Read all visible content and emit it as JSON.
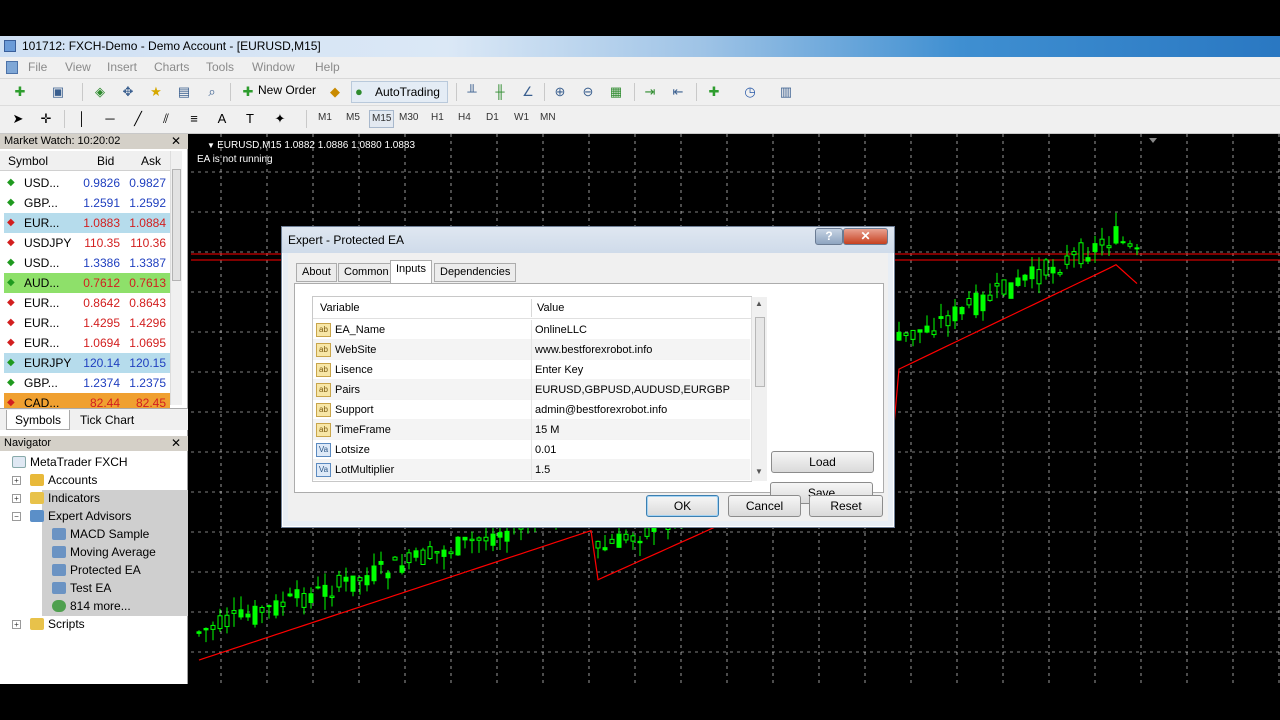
{
  "window": {
    "title": "101712: FXCH-Demo - Demo Account - [EURUSD,M15]"
  },
  "menu": [
    "File",
    "View",
    "Insert",
    "Charts",
    "Tools",
    "Window",
    "Help"
  ],
  "toolbar": {
    "new_order_label": "New Order",
    "autotrading_label": "AutoTrading",
    "timeframes": [
      "M1",
      "M5",
      "M15",
      "M30",
      "H1",
      "H4",
      "D1",
      "W1",
      "MN"
    ],
    "active_timeframe": "M15"
  },
  "market_watch": {
    "title": "Market Watch: 10:20:02",
    "columns": {
      "symbol": "Symbol",
      "bid": "Bid",
      "ask": "Ask"
    },
    "rows": [
      {
        "symbol": "USD...",
        "bid": "0.9826",
        "ask": "0.9827",
        "dir": "up",
        "bg": "#ffffff",
        "color": "#1f3fbf"
      },
      {
        "symbol": "GBP...",
        "bid": "1.2591",
        "ask": "1.2592",
        "dir": "up",
        "bg": "#ffffff",
        "color": "#1f3fbf"
      },
      {
        "symbol": "EUR...",
        "bid": "1.0883",
        "ask": "1.0884",
        "dir": "down",
        "bg": "#b6dcec",
        "color": "#d21f1f"
      },
      {
        "symbol": "USDJPY",
        "bid": "110.35",
        "ask": "110.36",
        "dir": "down",
        "bg": "#ffffff",
        "color": "#d21f1f"
      },
      {
        "symbol": "USD...",
        "bid": "1.3386",
        "ask": "1.3387",
        "dir": "up",
        "bg": "#ffffff",
        "color": "#1f3fbf"
      },
      {
        "symbol": "AUD...",
        "bid": "0.7612",
        "ask": "0.7613",
        "dir": "up",
        "bg": "#8ee06a",
        "color": "#d21f1f"
      },
      {
        "symbol": "EUR...",
        "bid": "0.8642",
        "ask": "0.8643",
        "dir": "down",
        "bg": "#ffffff",
        "color": "#d21f1f"
      },
      {
        "symbol": "EUR...",
        "bid": "1.4295",
        "ask": "1.4296",
        "dir": "down",
        "bg": "#ffffff",
        "color": "#d21f1f"
      },
      {
        "symbol": "EUR...",
        "bid": "1.0694",
        "ask": "1.0695",
        "dir": "down",
        "bg": "#ffffff",
        "color": "#d21f1f"
      },
      {
        "symbol": "EURJPY",
        "bid": "120.14",
        "ask": "120.15",
        "dir": "up",
        "bg": "#b6dcec",
        "color": "#1f3fbf"
      },
      {
        "symbol": "GBP...",
        "bid": "1.2374",
        "ask": "1.2375",
        "dir": "up",
        "bg": "#ffffff",
        "color": "#1f3fbf"
      },
      {
        "symbol": "CAD...",
        "bid": "82.44",
        "ask": "82.45",
        "dir": "down",
        "bg": "#f0a030",
        "color": "#d21f1f"
      }
    ],
    "tabs": [
      "Symbols",
      "Tick Chart"
    ]
  },
  "navigator": {
    "title": "Navigator",
    "root": "MetaTrader FXCH",
    "items": [
      {
        "label": "Accounts"
      },
      {
        "label": "Indicators"
      },
      {
        "label": "Expert Advisors"
      },
      {
        "label": "MACD Sample"
      },
      {
        "label": "Moving Average"
      },
      {
        "label": "Protected EA"
      },
      {
        "label": "Test EA"
      },
      {
        "label": "814 more..."
      },
      {
        "label": "Scripts"
      }
    ]
  },
  "chart": {
    "info": "EURUSD,M15  1.0882 1.0886 1.0880 1.0883",
    "ea_status": "EA is not running",
    "up_color": "#00ff00",
    "ma_color": "#ff0000",
    "grid_color": "#ffffff"
  },
  "dialog": {
    "title": "Expert - Protected EA",
    "help": "?",
    "tabs": [
      "About",
      "Common",
      "Inputs",
      "Dependencies"
    ],
    "active_tab": "Inputs",
    "columns": {
      "variable": "Variable",
      "value": "Value"
    },
    "rows": [
      {
        "type": "ab",
        "variable": "EA_Name",
        "value": "OnlineLLC"
      },
      {
        "type": "ab",
        "variable": "WebSite",
        "value": "www.bestforexrobot.info"
      },
      {
        "type": "ab",
        "variable": "Lisence",
        "value": "Enter Key"
      },
      {
        "type": "ab",
        "variable": "Pairs",
        "value": "EURUSD,GBPUSD,AUDUSD,EURGBP"
      },
      {
        "type": "ab",
        "variable": "Support",
        "value": "admin@bestforexrobot.info"
      },
      {
        "type": "ab",
        "variable": "TimeFrame",
        "value": "15 M"
      },
      {
        "type": "val",
        "variable": "Lotsize",
        "value": "0.01"
      },
      {
        "type": "val",
        "variable": "LotMultiplier",
        "value": "1.5"
      }
    ],
    "load_label": "Load",
    "save_label": "Save",
    "ok_label": "OK",
    "cancel_label": "Cancel",
    "reset_label": "Reset"
  }
}
